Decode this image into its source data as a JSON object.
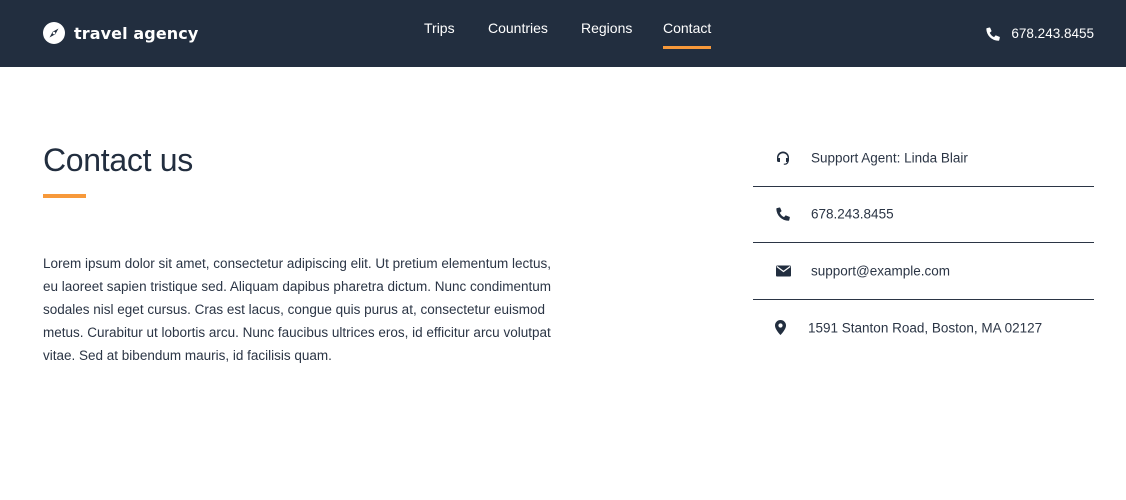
{
  "header": {
    "brand": "travel agency",
    "nav": [
      {
        "label": "Trips",
        "active": false
      },
      {
        "label": "Countries",
        "active": false
      },
      {
        "label": "Regions",
        "active": false
      },
      {
        "label": "Contact",
        "active": true
      }
    ],
    "phone": "678.243.8455"
  },
  "main": {
    "title": "Contact us",
    "intro": "Lorem ipsum dolor sit amet, consectetur adipiscing elit. Ut pretium elementum lectus, eu laoreet sapien tristique sed. Aliquam dapibus pharetra dictum. Nunc condimentum sodales nisl eget cursus. Cras est lacus, congue quis purus at, consectetur euismod metus. Curabitur ut lobortis arcu. Nunc faucibus ultrices eros, id efficitur arcu volutpat vitae. Sed at bibendum mauris, id facilisis quam."
  },
  "contact": {
    "items": [
      {
        "icon": "headset-icon",
        "text": "Support Agent: Linda Blair"
      },
      {
        "icon": "phone-icon",
        "text": "678.243.8455"
      },
      {
        "icon": "envelope-icon",
        "text": "support@example.com"
      },
      {
        "icon": "map-marker-icon",
        "text": "1591 Stanton Road, Boston, MA 02127"
      }
    ]
  },
  "colors": {
    "header_bg": "#222e3f",
    "accent": "#f7993a",
    "text": "#2b3545"
  }
}
